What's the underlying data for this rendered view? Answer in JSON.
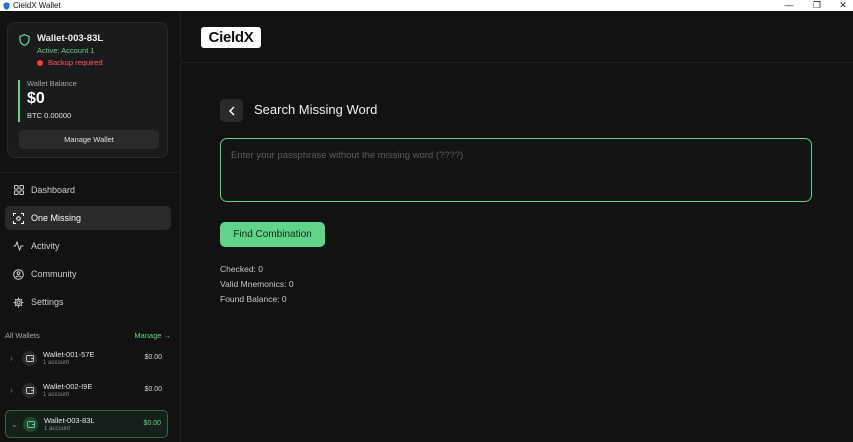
{
  "window": {
    "title": "CieldX Wallet",
    "controls": [
      "—",
      "❐",
      "✕"
    ]
  },
  "sidebar": {
    "wallet_card": {
      "name": "Wallet-003-83L",
      "active": "Active: Account 1",
      "backup": "Backup required",
      "balance_label": "Wallet Balance",
      "balance_value": "$0",
      "btc": "BTC 0.00000",
      "manage_label": "Manage Wallet"
    },
    "nav": [
      {
        "label": "Dashboard",
        "icon": "grid-icon"
      },
      {
        "label": "One Missing",
        "icon": "scan-icon",
        "active": true
      },
      {
        "label": "Activity",
        "icon": "activity-icon"
      },
      {
        "label": "Community",
        "icon": "community-icon"
      },
      {
        "label": "Settings",
        "icon": "gear-icon"
      }
    ],
    "wallets_header": "All Wallets",
    "wallets_manage": "Manage →",
    "wallets": [
      {
        "name": "Wallet-001-57E",
        "sub": "1 account",
        "amount": "$0.00"
      },
      {
        "name": "Wallet-002-I9E",
        "sub": "1 account",
        "amount": "$0.00"
      },
      {
        "name": "Wallet-003-83L",
        "sub": "1 account",
        "amount": "$0.00",
        "active": true
      }
    ]
  },
  "main": {
    "logo_text": "CieldX",
    "page_title": "Search Missing Word",
    "phrase_placeholder": "Enter your passphrase without the missing word (????)",
    "find_button": "Find Combination",
    "stats": {
      "checked": "Checked: 0",
      "valid": "Valid Mnemonics: 0",
      "found": "Found Balance: 0"
    }
  },
  "colors": {
    "accent": "#5fd48a",
    "danger": "#ff3b3b",
    "background": "#121212"
  }
}
